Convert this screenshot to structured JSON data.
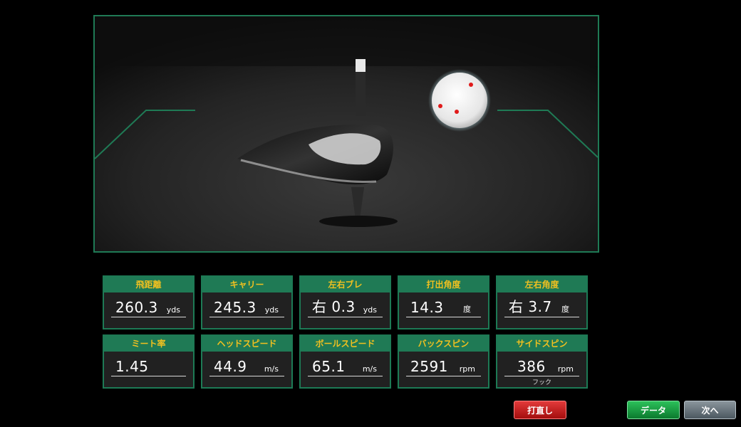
{
  "metrics": [
    {
      "label": "飛距離",
      "value": "260.3",
      "unit": "yds"
    },
    {
      "label": "キャリー",
      "value": "245.3",
      "unit": "yds"
    },
    {
      "label": "左右ブレ",
      "value": "右 0.3",
      "unit": "yds"
    },
    {
      "label": "打出角度",
      "value": "14.3",
      "unit": "度"
    },
    {
      "label": "左右角度",
      "value": "右 3.7",
      "unit": "度"
    },
    {
      "label": "ミート率",
      "value": "1.45",
      "unit": ""
    },
    {
      "label": "ヘッドスピード",
      "value": "44.9",
      "unit": "m/s"
    },
    {
      "label": "ボールスピード",
      "value": "65.1",
      "unit": "m/s"
    },
    {
      "label": "バックスピン",
      "value": "2591",
      "unit": "rpm"
    },
    {
      "label": "サイドスピン",
      "value": "386",
      "unit": "rpm",
      "sub": "フック"
    }
  ],
  "buttons": {
    "retry": "打直し",
    "data": "データ",
    "next": "次へ"
  },
  "colors": {
    "header_bg": "#1f7a55",
    "header_text": "#f0c020",
    "retry_button": "#c01818",
    "data_button": "#19994a",
    "next_button": "#6a767e"
  }
}
